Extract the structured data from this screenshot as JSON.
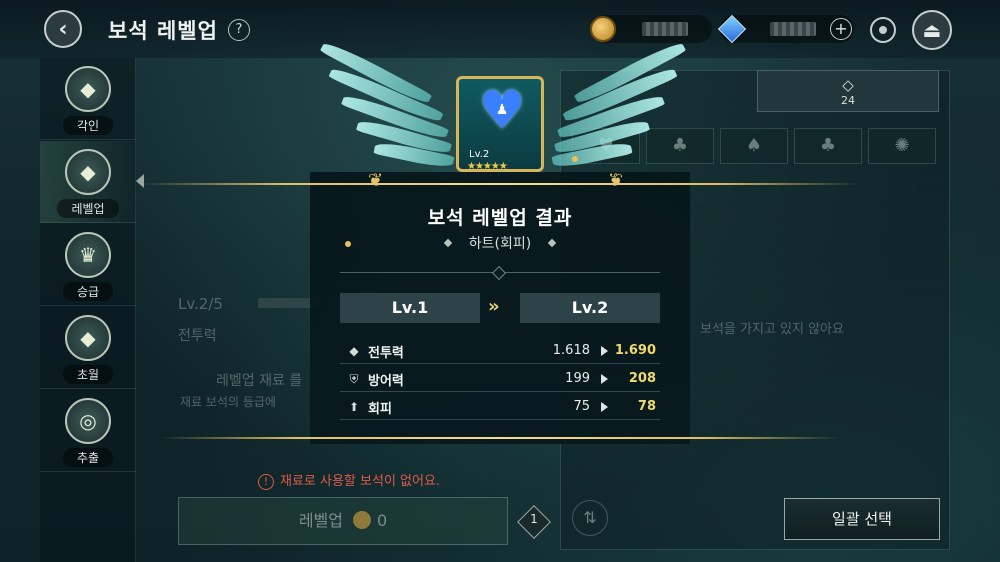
{
  "header": {
    "title": "보석 레벨업",
    "help_icon": "?",
    "back_icon": "‹",
    "exit_icon": "⏏"
  },
  "sidebar": {
    "items": [
      {
        "label": "각인",
        "icon": "◆"
      },
      {
        "label": "레벨업",
        "icon": "◆"
      },
      {
        "label": "승급",
        "icon": "♛"
      },
      {
        "label": "초월",
        "icon": "◆"
      },
      {
        "label": "추출",
        "icon": "◎"
      }
    ],
    "active_index": 1
  },
  "background": {
    "level_text": "Lv.2/5",
    "power_label": "전투력",
    "material_hint": "레벨업 재료 를",
    "material_hint2": "재료 보석의 등급에",
    "warning": "재료로 사용할 보석이 없어요.",
    "levelup_button": "레벨업",
    "levelup_cost": "0",
    "badge_count": "1",
    "gem_tab_count": "24",
    "empty_text": "보석을 가지고 있지 않아요",
    "bulk_select": "일괄 선택"
  },
  "modal": {
    "gem_level": "Lv.2",
    "gem_stars": "★★★★★",
    "title": "보석 레벨업 결과",
    "subtitle": "하트(회피)",
    "from_level": "Lv.1",
    "to_level": "Lv.2",
    "arrows": "»",
    "stats": [
      {
        "name": "전투력",
        "old": "1.618",
        "new": "1.690",
        "icon": "◆"
      },
      {
        "name": "방어력",
        "old": "199",
        "new": "208",
        "icon": "⛨"
      },
      {
        "name": "회피",
        "old": "75",
        "new": "78",
        "icon": "⬆"
      }
    ]
  },
  "colors": {
    "accent_gold": "#e0bd66",
    "stat_new": "#f1da6c",
    "warning": "#e05a4a"
  }
}
